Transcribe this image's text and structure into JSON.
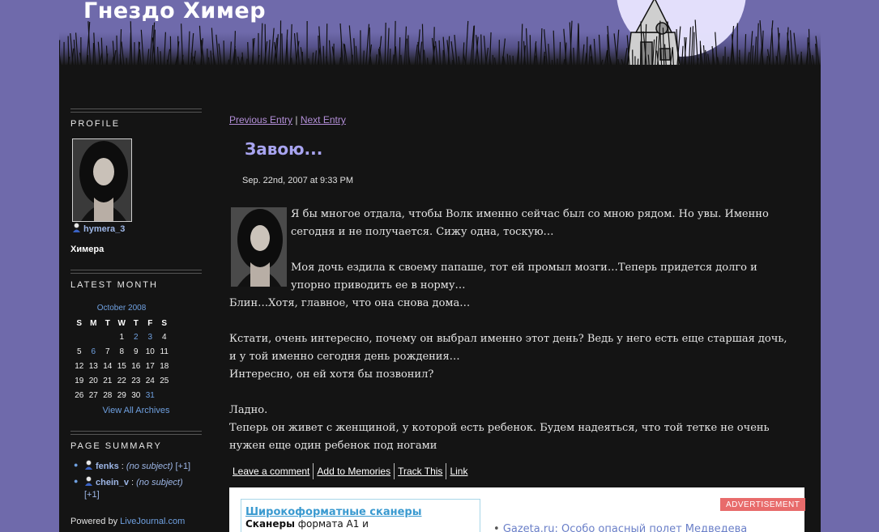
{
  "site": {
    "title": "Гнездо Химер"
  },
  "sidebar": {
    "profile": {
      "heading": "PROFILE",
      "username": "hymera_3",
      "display_name": "Химера"
    },
    "latest_month": {
      "heading": "LATEST MONTH",
      "month": "October 2008",
      "weekdays": [
        "S",
        "M",
        "T",
        "W",
        "T",
        "F",
        "S"
      ],
      "weeks": [
        [
          "",
          "",
          "",
          "1",
          "2",
          "3",
          "4"
        ],
        [
          "5",
          "6",
          "7",
          "8",
          "9",
          "10",
          "11"
        ],
        [
          "12",
          "13",
          "14",
          "15",
          "16",
          "17",
          "18"
        ],
        [
          "19",
          "20",
          "21",
          "22",
          "23",
          "24",
          "25"
        ],
        [
          "26",
          "27",
          "28",
          "29",
          "30",
          "31",
          ""
        ]
      ],
      "linked_days": [
        "2",
        "3",
        "6",
        "31"
      ],
      "archives_link": "View All Archives"
    },
    "page_summary": {
      "heading": "PAGE SUMMARY",
      "items": [
        {
          "user": "fenks",
          "sep": " : ",
          "subject": "(no subject)",
          "more": " [+1]"
        },
        {
          "user": "chein_v",
          "sep": " : ",
          "subject": "(no subject)",
          "more": "[+1]"
        }
      ]
    },
    "powered_prefix": "Powered by ",
    "powered_link": "LiveJournal.com"
  },
  "entry": {
    "nav": {
      "prev": "Previous Entry",
      "sep": " | ",
      "next": "Next Entry"
    },
    "title": "Завою...",
    "date": "Sep. 22nd, 2007 at 9:33 PM",
    "paragraphs": [
      "Я бы многое отдала, чтобы Волк именно сейчас был со мною рядом. Но увы. Именно сегодня и не получается. Сижу одна, тоскую…",
      "",
      "Моя дочь ездила к своему папаше, тот ей промыл мозги…Теперь придется долго и упорно приводить ее в норму…",
      "Блин…Хотя, главное, что она снова дома…",
      "",
      "Кстати, очень интересно, почему он выбрал именно этот день? Ведь у него есть еще старшая дочь, и у той именно сегодня день рождения…",
      "Интересно, он ей хотя бы позвонил?",
      "",
      "Ладно.",
      "Теперь он живет с женщиной, у которой есть ребенок. Будем надеяться, что той тетке не очень нужен еще один ребенок под ногами"
    ],
    "actions": [
      "Leave a comment",
      "Add to Memories",
      "Track This",
      "Link"
    ]
  },
  "ad": {
    "title": "Широкоформатные сканеры",
    "text_bold": "Сканеры",
    "text_rest": " формата А1 и",
    "label": "ADVERTISEMENT",
    "news_source": "Gazeta.ru:",
    "news_headline": "Особо опасный полет Медведева"
  },
  "colors": {
    "page_bg": "#6f6aab",
    "frame_bg": "#141414",
    "link": "#6fa0e0",
    "title": "#a8a4f0"
  }
}
